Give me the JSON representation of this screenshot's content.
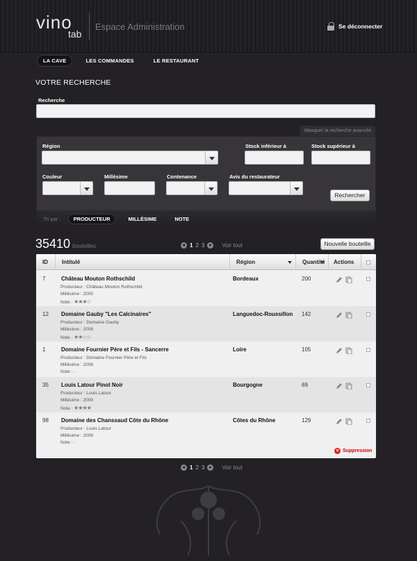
{
  "header": {
    "logo_text": "vino",
    "logo_sub": "tab",
    "title": "Espace Administration",
    "logout": "Se déconnecter"
  },
  "nav": [
    "LA CAVE",
    "LES COMMANDES",
    "LE RESTAURANT"
  ],
  "search": {
    "section_title": "VOTRE RECHERCHE",
    "label": "Recherche",
    "value": "",
    "toggle_advanced": "Masquer la recherche avancée",
    "region_label": "Région",
    "stock_min_label": "Stock inférieur à",
    "stock_max_label": "Stock supérieur à",
    "color_label": "Couleur",
    "vintage_label": "Millésime",
    "capacity_label": "Contenance",
    "opinion_label": "Avis du restaurateur",
    "submit": "Rechercher"
  },
  "sort": {
    "label": "Tri par :",
    "items": [
      "PRODUCTEUR",
      "MILLÉSIME",
      "NOTE"
    ]
  },
  "results": {
    "count": "35410",
    "unit": "bouteilles",
    "pages": [
      "1",
      "2",
      "3"
    ],
    "see_all": "Voir tout",
    "new_button": "Nouvelle bouteille"
  },
  "table": {
    "headers": {
      "id": "ID",
      "title": "Intitulé",
      "region": "Région",
      "qty": "Quantité",
      "actions": "Actions"
    },
    "rows": [
      {
        "id": "7",
        "title": "Château Mouton Rothschild",
        "producer": "Producteur : Château Mouton Rothschild",
        "vintage": "Millésime : 2005",
        "note_label": "Note :",
        "stars": "★★★☆",
        "region": "Bordeaux",
        "qty": "200"
      },
      {
        "id": "12",
        "title": "Domaine Gauby \"Les Calcinaires\"",
        "producer": "Producteur : Domaine Gauby",
        "vintage": "Millésime : 2008",
        "note_label": "Note :",
        "stars": "★★☆☆",
        "region": "Languedoc-Roussillon",
        "qty": "142"
      },
      {
        "id": "1",
        "title": "Domaine Fournier Père et Fils - Sancerre",
        "producer": "Producteur : Domaine Fournier Père et Fils",
        "vintage": "Millésime : 2008",
        "note_label": "Note :",
        "stars": "-",
        "region": "Loire",
        "qty": "105"
      },
      {
        "id": "35",
        "title": "Louis Latour Pinot Noir",
        "producer": "Producteur : Louis Latour",
        "vintage": "Millésime : 2009",
        "note_label": "Note :",
        "stars": "★★★★",
        "region": "Bourgogne",
        "qty": "69"
      },
      {
        "id": "98",
        "title": "Domaine des Chanssaud Côte du Rhône",
        "producer": "Producteur : Louis Latour",
        "vintage": "Millésime : 2009",
        "note_label": "Note :",
        "stars": "-",
        "region": "Côtes du Rhône",
        "qty": "129"
      }
    ],
    "delete_label": "Suppression"
  },
  "colors": {
    "background": "#232125",
    "accent_delete": "#d22222"
  }
}
